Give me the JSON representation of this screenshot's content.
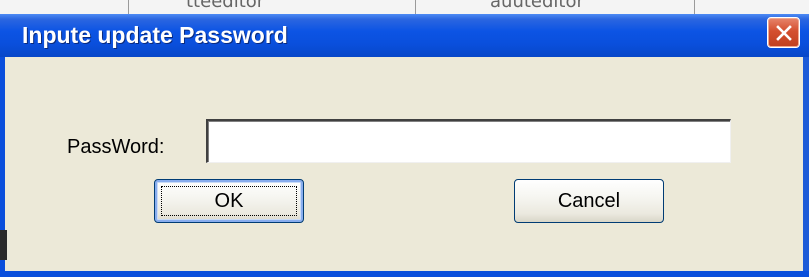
{
  "background_window": {
    "fragments": [
      "tteeditor",
      "auuteditor"
    ]
  },
  "dialog": {
    "title": "Inpute update Password",
    "close_icon": "close-icon",
    "titlebar_color": "#0a4fdc",
    "close_color": "#d4502f",
    "password_label": "PassWord:",
    "password_value": "",
    "ok_label": "OK",
    "cancel_label": "Cancel"
  }
}
